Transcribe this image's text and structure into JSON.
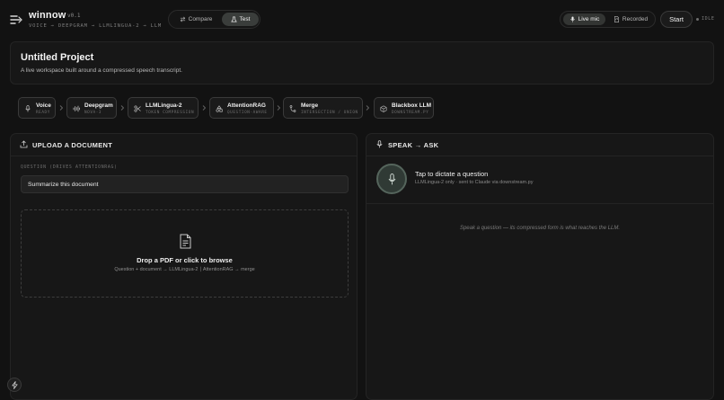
{
  "header": {
    "brand": "winnow",
    "version": "v0.1",
    "subtitle": "VOICE → DEEPGRAM → LLMLINGUA-2 → LLM",
    "modes": {
      "compare": "Compare",
      "test": "Test",
      "active": "Test"
    },
    "mic": {
      "live": "Live mic",
      "recorded": "Recorded",
      "active": "Live mic"
    },
    "start_label": "Start",
    "status": "IDLE"
  },
  "project": {
    "title": "Untitled Project",
    "description": "A live workspace built around a compressed speech transcript."
  },
  "pipeline": [
    {
      "name": "Voice",
      "sub": "READY",
      "icon": "mic-icon"
    },
    {
      "name": "Deepgram",
      "sub": "NOVA-3",
      "icon": "waveform-icon"
    },
    {
      "name": "LLMLingua-2",
      "sub": "TOKEN COMPRESSION",
      "icon": "scissors-icon"
    },
    {
      "name": "AttentionRAG",
      "sub": "QUESTION-AWARE",
      "icon": "shapes-icon"
    },
    {
      "name": "Merge",
      "sub": "INTERSECTION / UNION",
      "icon": "merge-icon"
    },
    {
      "name": "Blackbox LLM",
      "sub": "DOWNSTREAM.PY",
      "icon": "box-icon"
    }
  ],
  "upload_panel": {
    "title": "UPLOAD A DOCUMENT",
    "question_label": "QUESTION (DRIVES ATTENTIONRAG)",
    "question_value": "Summarize this document",
    "drop_title": "Drop a PDF or click to browse",
    "drop_sub": "Question + document → LLMLingua-2 ∣ AttentionRAG → merge"
  },
  "speak_panel": {
    "title": "SPEAK → ASK",
    "mic_title": "Tap to dictate a question",
    "mic_sub": "LLMLingua-2 only · sent to Claude via downstream.py",
    "placeholder": "Speak a question — its compressed form is what reaches the LLM."
  },
  "colors": {
    "background": "#121212",
    "panel": "#171717",
    "accent_mic": "#303a35"
  }
}
